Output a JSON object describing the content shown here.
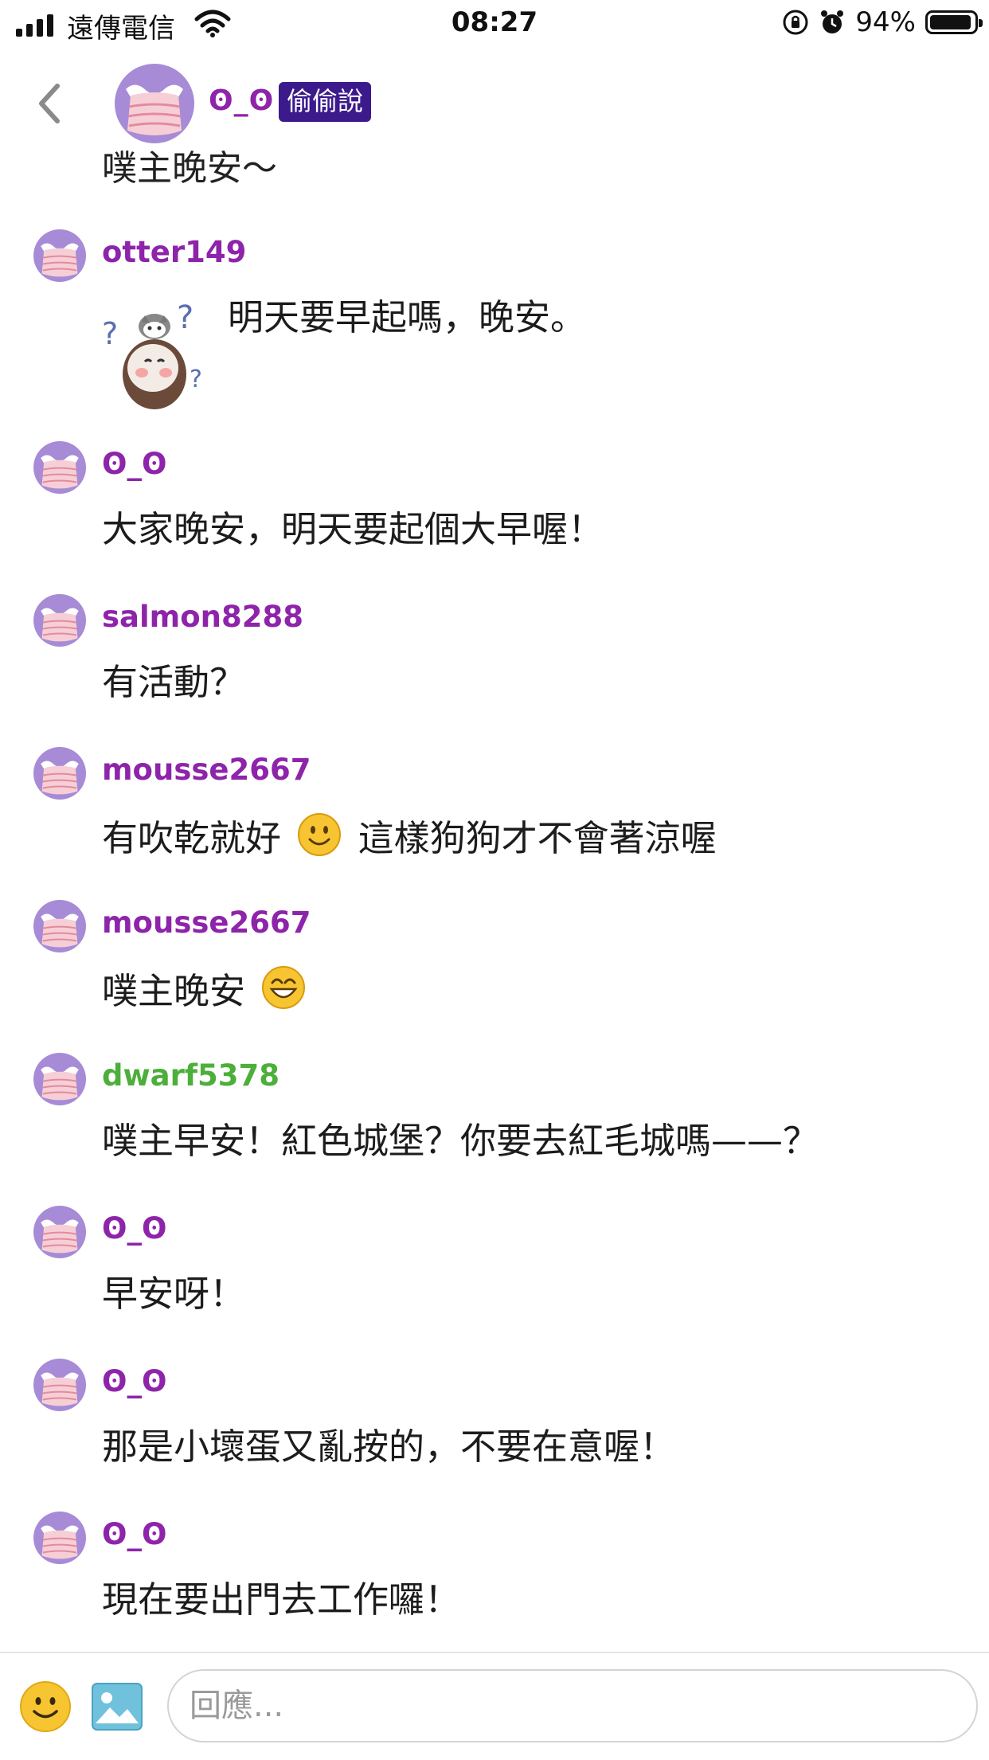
{
  "status_bar": {
    "carrier": "遠傳電信",
    "time": "08:27",
    "battery_percent": "94%",
    "battery_level": 0.94,
    "icons": [
      "signal-icon",
      "wifi-icon",
      "orientation-lock-icon",
      "alarm-icon",
      "battery-icon"
    ]
  },
  "header": {
    "back_icon": "chevron-left-icon",
    "poster_name": "ʘ_ʘ",
    "badge": "偷偷說",
    "message": "噗主晚安～"
  },
  "colors": {
    "purple_name": "#8e24aa",
    "green_name": "#4caf3a",
    "badge_bg": "#3c1a8c",
    "avatar_purple": "#a78bd6",
    "avatar_pink": "#f6cfd6"
  },
  "responses": [
    {
      "user": "otter149",
      "user_color": "#8e24aa",
      "sticker": "confused-bird-sticker",
      "text": "明天要早起嗎，晚安。"
    },
    {
      "user": "ʘ_ʘ",
      "user_color": "#8e24aa",
      "text": "大家晚安，明天要起個大早喔！"
    },
    {
      "user": "salmon8288",
      "user_color": "#8e24aa",
      "text": "有活動？"
    },
    {
      "user": "mousse2667",
      "user_color": "#8e24aa",
      "text_before": "有吹乾就好",
      "emoji": "smile-emoji",
      "text_after": "這樣狗狗才不會著涼喔"
    },
    {
      "user": "mousse2667",
      "user_color": "#8e24aa",
      "text_before": "噗主晚安",
      "emoji": "grin-emoji",
      "text_after": ""
    },
    {
      "user": "dwarf5378",
      "user_color": "#4caf3a",
      "text": "噗主早安！紅色城堡？你要去紅毛城嗎——？"
    },
    {
      "user": "ʘ_ʘ",
      "user_color": "#8e24aa",
      "text": "早安呀！"
    },
    {
      "user": "ʘ_ʘ",
      "user_color": "#8e24aa",
      "text": "那是小壞蛋又亂按的，不要在意喔！"
    },
    {
      "user": "ʘ_ʘ",
      "user_color": "#8e24aa",
      "text": "現在要出門去工作囉！"
    }
  ],
  "reply_bar": {
    "emoji_icon": "emoji-picker-icon",
    "image_icon": "image-upload-icon",
    "placeholder": "回應...",
    "value": ""
  }
}
